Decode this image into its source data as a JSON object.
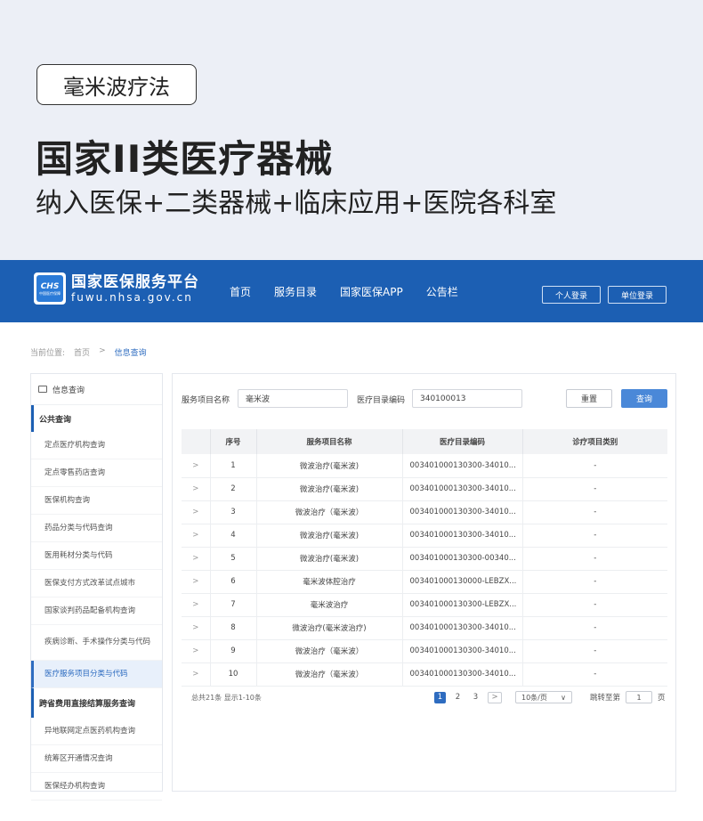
{
  "promo": {
    "tag": "毫米波疗法",
    "headline": "国家II类医疗器械",
    "subline": "纳入医保+二类器械+临床应用+医院各科室"
  },
  "nav": {
    "logo_badge": "CHS",
    "logo_badge_sub": "中国医疗保障",
    "logo_title": "国家医保服务平台",
    "logo_url": "fuwu.nhsa.gov.cn",
    "links": [
      "首页",
      "服务目录",
      "国家医保APP",
      "公告栏"
    ],
    "personal_login": "个人登录",
    "unit_login": "单位登录",
    "bg_color": "#1c5fb3"
  },
  "breadcrumb": {
    "prefix": "当前位置:",
    "home": "首页",
    "separator": ">",
    "current": "信息查询"
  },
  "sidebar": {
    "header": "信息查询",
    "groups": [
      {
        "title": "公共查询",
        "items": [
          "定点医疗机构查询",
          "定点零售药店查询",
          "医保机构查询",
          "药品分类与代码查询",
          "医用耗材分类与代码",
          "医保支付方式改革试点城市",
          "国家谈判药品配备机构查询",
          "疾病诊断、手术操作分类与代码",
          "医疗服务项目分类与代码"
        ]
      },
      {
        "title": "跨省费用直接结算服务查询",
        "items": [
          "异地联网定点医药机构查询",
          "统筹区开通情况查询",
          "医保经办机构查询"
        ]
      }
    ],
    "active_item": "医疗服务项目分类与代码"
  },
  "search": {
    "name_label": "服务项目名称",
    "name_value": "毫米波",
    "code_label": "医疗目录编码",
    "code_value": "340100013",
    "reset": "重置",
    "query": "查询"
  },
  "table": {
    "columns": [
      "序号",
      "服务项目名称",
      "医疗目录编码",
      "诊疗项目类别"
    ],
    "expand_icon": ">",
    "rows": [
      {
        "no": "1",
        "name": "微波治疗(毫米波)",
        "code": "003401000130300-34010...",
        "cat": "-"
      },
      {
        "no": "2",
        "name": "微波治疗(毫米波)",
        "code": "003401000130300-34010...",
        "cat": "-"
      },
      {
        "no": "3",
        "name": "微波治疗（毫米波）",
        "code": "003401000130300-34010...",
        "cat": "-"
      },
      {
        "no": "4",
        "name": "微波治疗(毫米波)",
        "code": "003401000130300-34010...",
        "cat": "-"
      },
      {
        "no": "5",
        "name": "微波治疗(毫米波)",
        "code": "003401000130300-00340...",
        "cat": "-"
      },
      {
        "no": "6",
        "name": "毫米波体腔治疗",
        "code": "003401000130000-LEBZX...",
        "cat": "-"
      },
      {
        "no": "7",
        "name": "毫米波治疗",
        "code": "003401000130300-LEBZX...",
        "cat": "-"
      },
      {
        "no": "8",
        "name": "微波治疗(毫米波治疗)",
        "code": "003401000130300-34010...",
        "cat": "-"
      },
      {
        "no": "9",
        "name": "微波治疗（毫米波）",
        "code": "003401000130300-34010...",
        "cat": "-"
      },
      {
        "no": "10",
        "name": "微波治疗（毫米波）",
        "code": "003401000130300-34010...",
        "cat": "-"
      }
    ]
  },
  "pagination": {
    "summary": "总共21条  显示1-10条",
    "pages": [
      "1",
      "2",
      "3"
    ],
    "current_page": "1",
    "next_icon": ">",
    "page_size": "10条/页",
    "page_size_icon": "∨",
    "jump_label": "跳转至第",
    "jump_value": "1",
    "jump_suffix": "页"
  }
}
